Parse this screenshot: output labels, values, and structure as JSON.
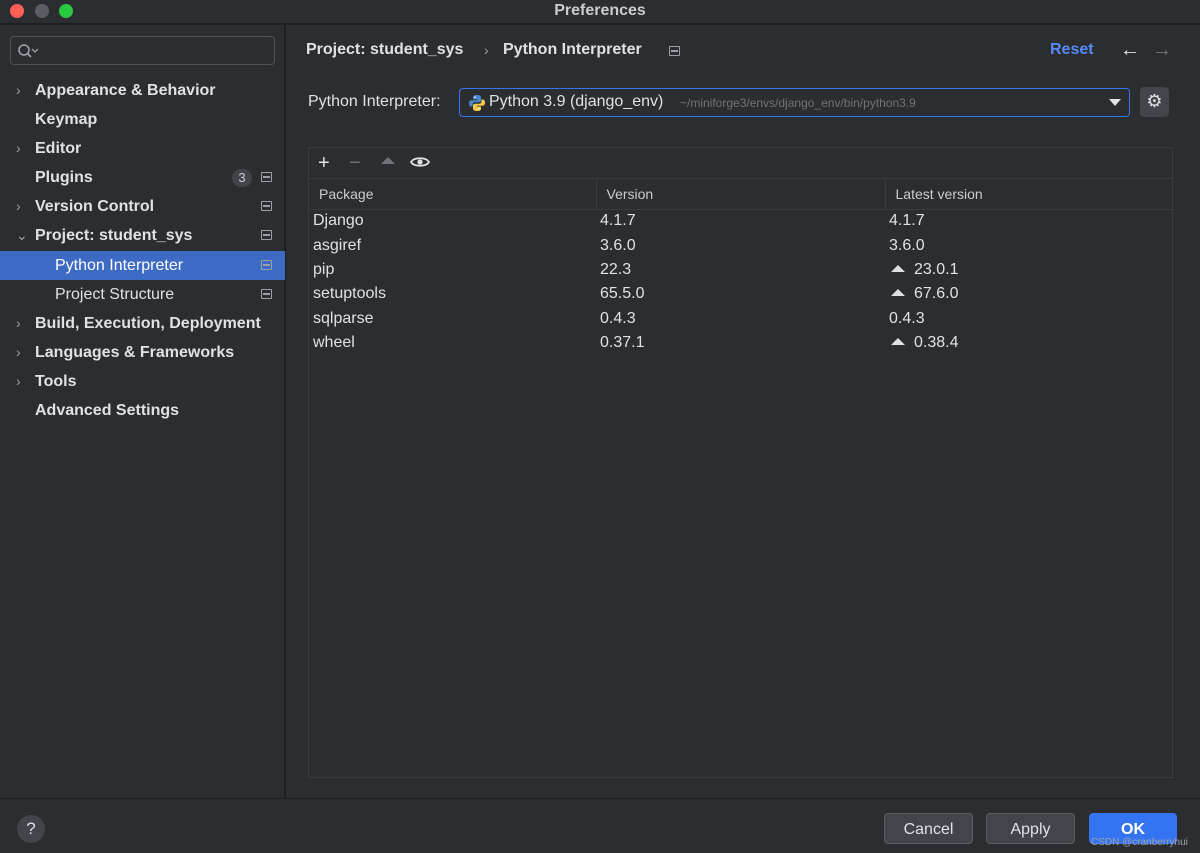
{
  "window": {
    "title": "Preferences"
  },
  "sidebar": {
    "items": [
      {
        "label": "Appearance & Behavior",
        "arrow": "›"
      },
      {
        "label": "Keymap"
      },
      {
        "label": "Editor",
        "arrow": "›"
      },
      {
        "label": "Plugins",
        "badge": "3"
      },
      {
        "label": "Version Control",
        "arrow": "›"
      },
      {
        "label": "Project: student_sys",
        "arrow": "⌄"
      },
      {
        "label": "Python Interpreter"
      },
      {
        "label": "Project Structure"
      },
      {
        "label": "Build, Execution, Deployment",
        "arrow": "›"
      },
      {
        "label": "Languages & Frameworks",
        "arrow": "›"
      },
      {
        "label": "Tools",
        "arrow": "›"
      },
      {
        "label": "Advanced Settings"
      }
    ]
  },
  "header": {
    "breadcrumb_parent": "Project: student_sys",
    "breadcrumb_separator": "›",
    "breadcrumb_current": "Python Interpreter",
    "reset_label": "Reset",
    "back_icon": "←",
    "forward_icon": "→"
  },
  "interpreter": {
    "label": "Python Interpreter:",
    "name": "Python 3.9 (django_env)",
    "path": "~/miniforge3/envs/django_env/bin/python3.9"
  },
  "toolbar": {
    "add": "+",
    "remove": "−"
  },
  "packages": {
    "columns": [
      "Package",
      "Version",
      "Latest version"
    ],
    "rows": [
      {
        "package": "Django",
        "version": "4.1.7",
        "latest": "4.1.7",
        "upgrade": false
      },
      {
        "package": "asgiref",
        "version": "3.6.0",
        "latest": "3.6.0",
        "upgrade": false
      },
      {
        "package": "pip",
        "version": "22.3",
        "latest": "23.0.1",
        "upgrade": true
      },
      {
        "package": "setuptools",
        "version": "65.5.0",
        "latest": "67.6.0",
        "upgrade": true
      },
      {
        "package": "sqlparse",
        "version": "0.4.3",
        "latest": "0.4.3",
        "upgrade": false
      },
      {
        "package": "wheel",
        "version": "0.37.1",
        "latest": "0.38.4",
        "upgrade": true
      }
    ]
  },
  "footer": {
    "help": "?",
    "cancel_label": "Cancel",
    "apply_label": "Apply",
    "ok_label": "OK",
    "watermark": "CSDN @cranberryhui"
  },
  "colors": {
    "accent": "#3574f0",
    "selected_bg": "#3d6bc4",
    "link": "#548af7",
    "window_bg": "#2b2d30"
  }
}
